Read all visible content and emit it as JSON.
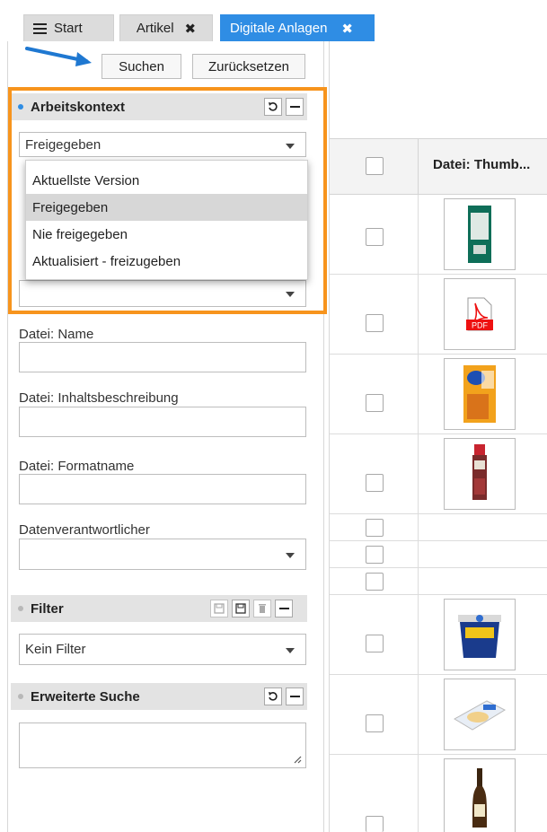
{
  "tabs": [
    {
      "label": "Start",
      "closable": false,
      "active": false
    },
    {
      "label": "Artikel",
      "closable": true,
      "active": false
    },
    {
      "label": "Digitale Anlagen",
      "closable": true,
      "active": true
    }
  ],
  "tab_close_glyph": "✖",
  "toolbar": {
    "search_label": "Suchen",
    "reset_label": "Zurücksetzen"
  },
  "context_section": {
    "title": "Arbeitskontext",
    "selected": "Freigegeben"
  },
  "dropdown_options": [
    "Aktuellste Version",
    "Freigegeben",
    "Nie freigegeben",
    "Aktualisiert - freizugeben"
  ],
  "dropdown_selected_index": 1,
  "fields": {
    "name_label": "Datei: Name",
    "description_label": "Datei: Inhaltsbeschreibung",
    "format_label": "Datei: Formatname",
    "owner_label": "Datenverantwortlicher"
  },
  "filter_section": {
    "title": "Filter",
    "selected": "Kein Filter"
  },
  "advanced_section": {
    "title": "Erweiterte Suche"
  },
  "table": {
    "thumb_header": "Datei: Thumb...",
    "rows": [
      {
        "thumb": "green-package"
      },
      {
        "thumb": "pdf-file-icon"
      },
      {
        "thumb": "orange-drink-box"
      },
      {
        "thumb": "red-sausage-pack"
      },
      {
        "thumb": "none"
      },
      {
        "thumb": "none"
      },
      {
        "thumb": "none"
      },
      {
        "thumb": "blue-bucket"
      },
      {
        "thumb": "wrapped-sandwich"
      },
      {
        "thumb": "beer-bottle"
      }
    ],
    "pdf_label": "PDF"
  },
  "colors": {
    "accent": "#2f8de4",
    "highlight": "#f7941d",
    "arrow": "#1f78d1"
  }
}
